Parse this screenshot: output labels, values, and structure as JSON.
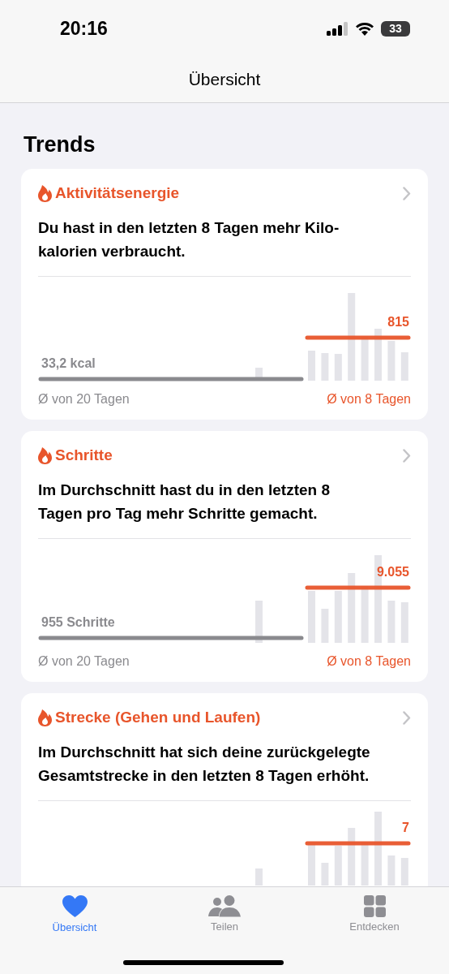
{
  "status_bar": {
    "time": "20:16",
    "battery": "33"
  },
  "nav": {
    "title": "Übersicht"
  },
  "section_title": "Trends",
  "cards": [
    {
      "title": "Aktivitätsenergie",
      "text_lines": [
        "Du hast in den letzten 8 Tagen mehr Kilo-",
        "kalorien verbraucht."
      ],
      "left_value": "33,2 kcal",
      "right_value": "815",
      "left_caption": "Ø von 20 Tagen",
      "right_caption": "Ø von 8 Tagen"
    },
    {
      "title": "Schritte",
      "text_lines": [
        "Im Durchschnitt hast du in den letzten 8",
        "Tagen pro Tag mehr Schritte gemacht."
      ],
      "left_value": "955 Schritte",
      "right_value": "9.055",
      "left_caption": "Ø von 20 Tagen",
      "right_caption": "Ø von 8 Tagen"
    },
    {
      "title": "Strecke (Gehen und Laufen)",
      "text_lines": [
        "Im Durchschnitt hat sich deine zurückgelegte",
        "Gesamtstrecke in den letzten 8 Tagen erhöht."
      ],
      "right_value": "7"
    }
  ],
  "tab_bar": [
    {
      "label": "Übersicht",
      "kind": "heart",
      "selected": true
    },
    {
      "label": "Teilen",
      "kind": "people",
      "selected": false
    },
    {
      "label": "Entdecken",
      "kind": "grid",
      "selected": false
    }
  ]
}
